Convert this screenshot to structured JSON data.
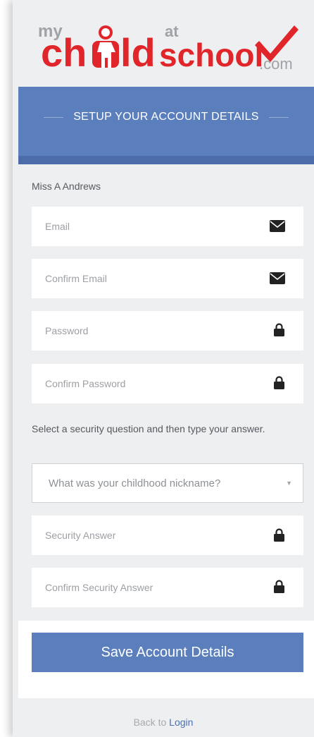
{
  "logo": {
    "my": "my",
    "ch": "ch",
    "ld": "ld",
    "at": "at",
    "school": "school",
    "com": ".com"
  },
  "header": {
    "title": "SETUP YOUR ACCOUNT DETAILS"
  },
  "user": {
    "name": "Miss A Andrews"
  },
  "fields": {
    "email": {
      "placeholder": "Email",
      "icon": "envelope-icon"
    },
    "confirm_email": {
      "placeholder": "Confirm Email",
      "icon": "envelope-icon"
    },
    "password": {
      "placeholder": "Password",
      "icon": "lock-icon"
    },
    "confirm_password": {
      "placeholder": "Confirm Password",
      "icon": "lock-icon"
    },
    "security_answer": {
      "placeholder": "Security Answer",
      "icon": "lock-icon"
    },
    "confirm_security_answer": {
      "placeholder": "Confirm Security Answer",
      "icon": "lock-icon"
    }
  },
  "security": {
    "help": "Select a security question and then type your answer.",
    "selected_question": "What was your childhood nickname?"
  },
  "actions": {
    "save_label": "Save Account Details"
  },
  "footer": {
    "prefix": "Back to ",
    "link_label": "Login"
  },
  "colors": {
    "brand_red": "#e0262b",
    "accent_blue": "#5b7fbd",
    "accent_blue_dark": "#4b6ca8",
    "page_bg": "#eeeff1"
  }
}
